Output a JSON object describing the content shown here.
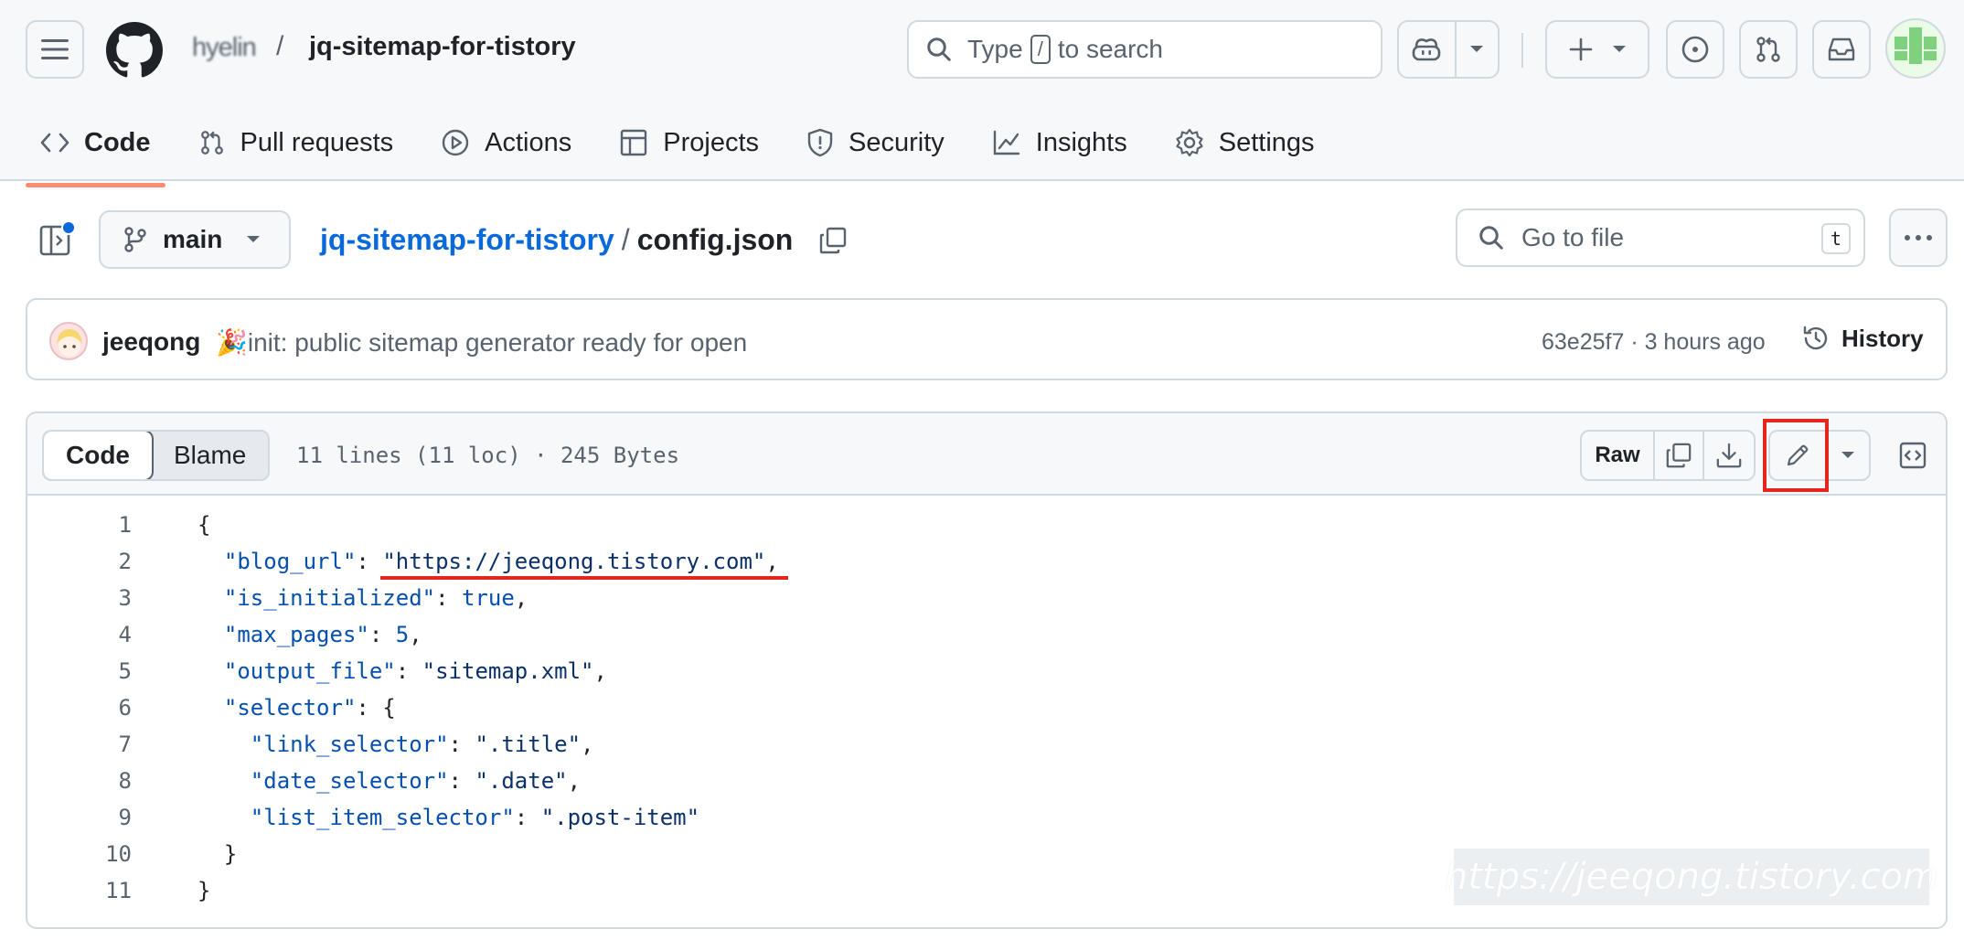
{
  "header": {
    "owner": "hyelin",
    "separator": "/",
    "repo": "jq-sitemap-for-tistory",
    "search": {
      "prefix": "Type",
      "key": "/",
      "suffix": "to search"
    }
  },
  "nav": {
    "items": [
      {
        "label": "Code",
        "icon": "code-icon",
        "active": true
      },
      {
        "label": "Pull requests",
        "icon": "git-pull-request-icon"
      },
      {
        "label": "Actions",
        "icon": "play-icon"
      },
      {
        "label": "Projects",
        "icon": "table-icon"
      },
      {
        "label": "Security",
        "icon": "shield-icon"
      },
      {
        "label": "Insights",
        "icon": "graph-icon"
      },
      {
        "label": "Settings",
        "icon": "gear-icon"
      }
    ]
  },
  "file_nav": {
    "branch": "main",
    "repo_link": "jq-sitemap-for-tistory",
    "path_separator": "/",
    "file_name": "config.json",
    "goto_placeholder": "Go to file",
    "goto_key": "t"
  },
  "commit": {
    "author": "jeeqong",
    "emoji": "🎉",
    "message": "init: public sitemap generator ready for open",
    "meta": "63e25f7 · 3 hours ago",
    "history_label": "History"
  },
  "code_view": {
    "tabs": [
      "Code",
      "Blame"
    ],
    "file_info": "11 lines (11 loc) · 245 Bytes",
    "raw_label": "Raw",
    "line_numbers": [
      "1",
      "2",
      "3",
      "4",
      "5",
      "6",
      "7",
      "8",
      "9",
      "10",
      "11"
    ]
  },
  "code": {
    "l2_key": "\"blog_url\"",
    "l2_val": "\"https://jeeqong.tistory.com\"",
    "l3_key": "\"is_initialized\"",
    "l3_val": "true",
    "l4_key": "\"max_pages\"",
    "l4_val": "5",
    "l5_key": "\"output_file\"",
    "l5_val": "\"sitemap.xml\"",
    "l6_key": "\"selector\"",
    "l7_key": "\"link_selector\"",
    "l7_val": "\".title\"",
    "l8_key": "\"date_selector\"",
    "l8_val": "\".date\"",
    "l9_key": "\"list_item_selector\"",
    "l9_val": "\".post-item\""
  },
  "watermark": "https://jeeqong.tistory.com",
  "colors": {
    "link": "#0969da",
    "active_underline": "#fd8c73",
    "annotation_red": "#e5261f"
  }
}
